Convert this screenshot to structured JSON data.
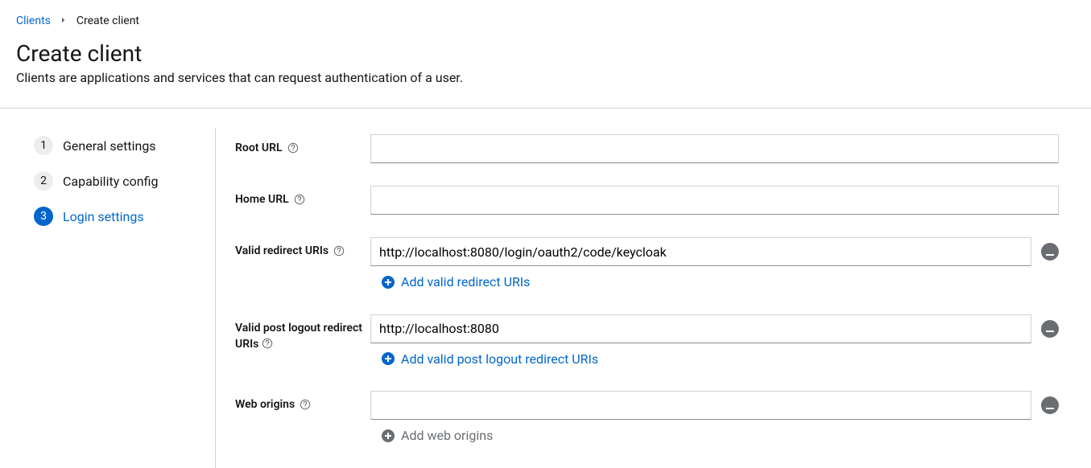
{
  "breadcrumb": {
    "parent": "Clients",
    "current": "Create client"
  },
  "header": {
    "title": "Create client",
    "description": "Clients are applications and services that can request authentication of a user."
  },
  "wizard": {
    "steps": [
      {
        "num": "1",
        "label": "General settings",
        "active": false
      },
      {
        "num": "2",
        "label": "Capability config",
        "active": false
      },
      {
        "num": "3",
        "label": "Login settings",
        "active": true
      }
    ]
  },
  "form": {
    "root_url": {
      "label": "Root URL",
      "value": ""
    },
    "home_url": {
      "label": "Home URL",
      "value": ""
    },
    "redirect_uris": {
      "label": "Valid redirect URIs",
      "value": "http://localhost:8080/login/oauth2/code/keycloak",
      "add_label": "Add valid redirect URIs"
    },
    "post_logout_uris": {
      "label": "Valid post logout redirect URIs",
      "value": "http://localhost:8080",
      "add_label": "Add valid post logout redirect URIs"
    },
    "web_origins": {
      "label": "Web origins",
      "value": "",
      "add_label": "Add web origins"
    }
  }
}
